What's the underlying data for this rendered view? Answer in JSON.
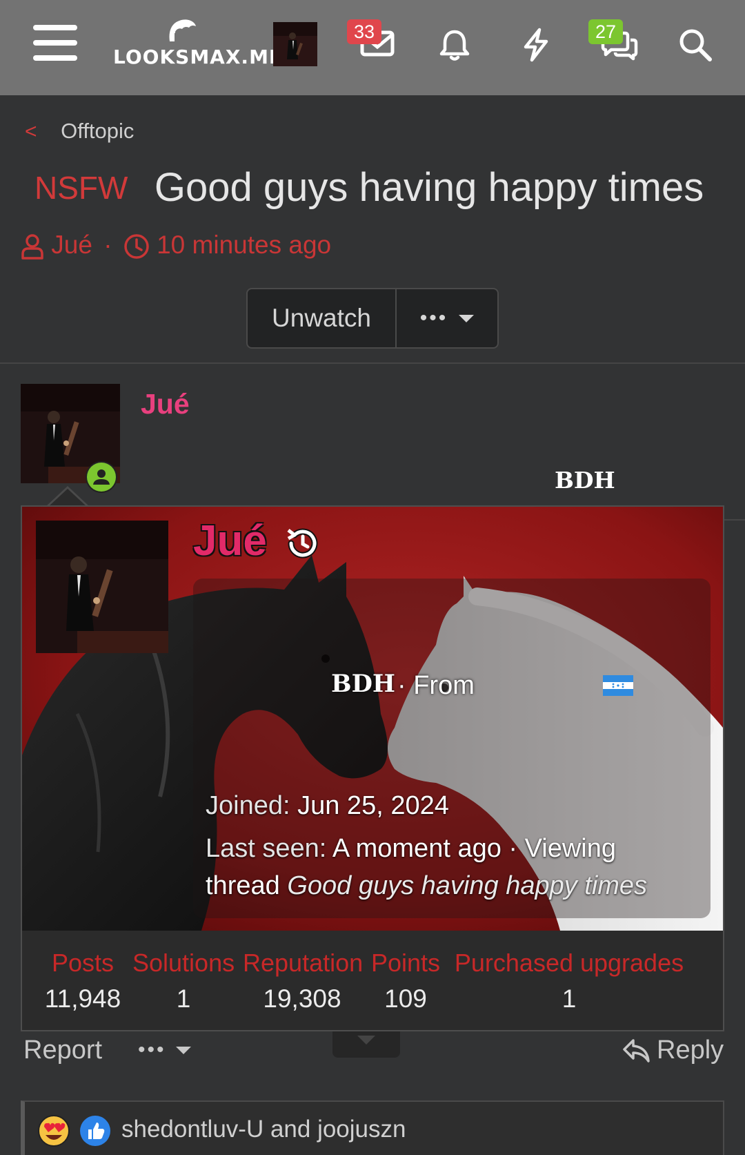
{
  "nav": {
    "logo_text": "LOOKSMAX.ME",
    "inbox_badge": "33",
    "chat_badge": "27",
    "icons": [
      "menu-icon",
      "logo-icon",
      "avatar",
      "inbox-icon",
      "bell-icon",
      "bolt-icon",
      "chat-icon",
      "search-icon"
    ]
  },
  "thread": {
    "breadcrumb": "Offtopic",
    "prefix": "NSFW",
    "title": "Good guys having happy times",
    "author": "Jué",
    "time": "10 minutes ago",
    "unwatch_label": "Unwatch",
    "more_label": "•••"
  },
  "post": {
    "username": "Jué",
    "user_title": "BDH"
  },
  "card": {
    "username": "Jué",
    "user_title": "BDH",
    "from_text": "· From",
    "joined_label": "Joined:",
    "joined_value": "Jun 25, 2024",
    "last_seen_label": "Last seen:",
    "last_seen_value": "A moment ago · Viewing",
    "thread_label": "thread",
    "thread_name": "Good guys having happy times",
    "stats": [
      {
        "label": "Posts",
        "value": "11,948"
      },
      {
        "label": "Solutions",
        "value": "1"
      },
      {
        "label": "Reputation",
        "value": "19,308"
      },
      {
        "label": "Points",
        "value": "109"
      },
      {
        "label": "Purchased upgrades",
        "value": "1"
      }
    ]
  },
  "footer": {
    "report_label": "Report",
    "more_label": "•••",
    "reply_label": "Reply",
    "reactions_text": "shedontluv-U and joojuszn"
  },
  "colors": {
    "nav_bg": "#737373",
    "page_bg": "#323334",
    "accent_red": "#d23a3a",
    "username_pink": "#e8407e",
    "badge_red": "#e0464c",
    "badge_green": "#7cc62f",
    "online_green": "#7cc62f"
  }
}
